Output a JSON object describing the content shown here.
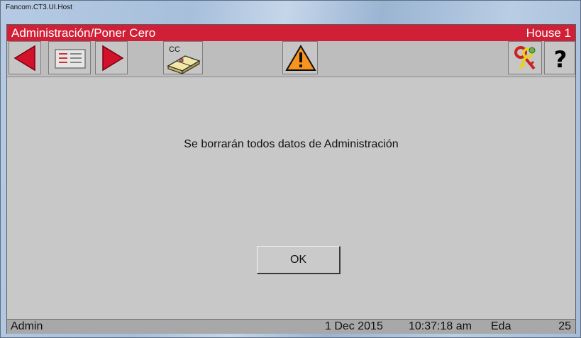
{
  "window": {
    "title": "Fancom.CT3.UI.Host"
  },
  "header": {
    "title": "Administración/Poner Cero",
    "house": "House 1"
  },
  "toolbar": {
    "cc_label": "CC",
    "help_label": "?",
    "icons": [
      "back-arrow-icon",
      "list-icon",
      "forward-arrow-icon",
      "cc-house-icon",
      "warning-icon",
      "keys-icon",
      "help-icon"
    ],
    "colors": {
      "arrow": "#d3112b",
      "warning": "#f7931e",
      "help": "#000000"
    }
  },
  "main": {
    "message": "Se borrarán todos datos de Administración",
    "ok_label": "OK"
  },
  "status": {
    "user": "Admin",
    "date": "1 Dec 2015",
    "time": "10:37:18 am",
    "age_label": "Eda",
    "age_value": "25"
  }
}
